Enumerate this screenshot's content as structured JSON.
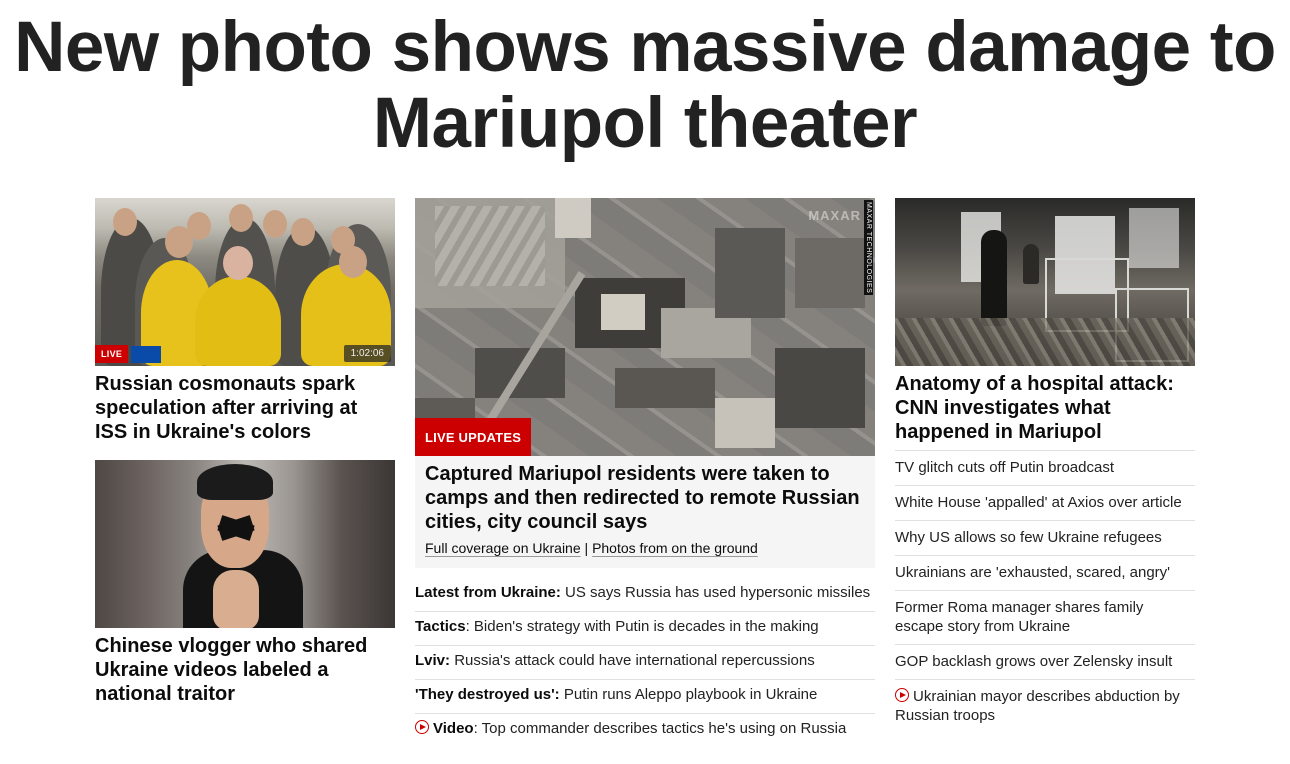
{
  "headline": "New photo shows massive damage to Mariupol theater",
  "left": {
    "card1": {
      "badge": "LIVE",
      "timecode": "1:02:06",
      "title": "Russian cosmonauts spark speculation after arriving at ISS in Ukraine's colors"
    },
    "card2": {
      "title": "Chinese vlogger who shared Ukraine videos labeled a national traitor"
    }
  },
  "middle": {
    "image_credit": "MAXAR TECHNOLOGIES",
    "image_watermark": "MAXAR",
    "badge": "LIVE UPDATES",
    "title": "Captured Mariupol residents were taken to camps and then redirected to remote Russian cities, city council says",
    "links": {
      "link1": "Full coverage on Ukraine",
      "separator": "|",
      "link2": "Photos from on the ground"
    },
    "items": [
      {
        "kicker": "Latest from Ukraine:",
        "text": "US says Russia has used hypersonic missiles"
      },
      {
        "kicker": "Tactics",
        "text": ": Biden's strategy with Putin is decades in the making"
      },
      {
        "kicker": "Lviv:",
        "text": "Russia's attack could have international repercussions"
      },
      {
        "kicker": "'They destroyed us':",
        "text": "Putin runs Aleppo playbook in Ukraine"
      },
      {
        "kicker": "Video",
        "text": ": Top commander describes tactics he's using on Russia",
        "icon": "play-icon"
      }
    ]
  },
  "right": {
    "title": "Anatomy of a hospital attack: CNN investigates what happened in Mariupol",
    "items": [
      {
        "text": "TV glitch cuts off Putin broadcast"
      },
      {
        "text": "White House 'appalled' at Axios over article"
      },
      {
        "text": "Why US allows so few Ukraine refugees"
      },
      {
        "text": "Ukrainians are 'exhausted, scared, angry'"
      },
      {
        "text": "Former Roma manager shares family escape story from Ukraine"
      },
      {
        "text": "GOP backlash grows over Zelensky insult"
      },
      {
        "text": "Ukrainian mayor describes abduction by Russian troops",
        "icon": "play-icon"
      }
    ]
  },
  "colors": {
    "accent_red": "#cc0000",
    "text": "#0c0c0c",
    "divider": "#e0e0e0",
    "featured_bg": "#f5f5f5"
  }
}
